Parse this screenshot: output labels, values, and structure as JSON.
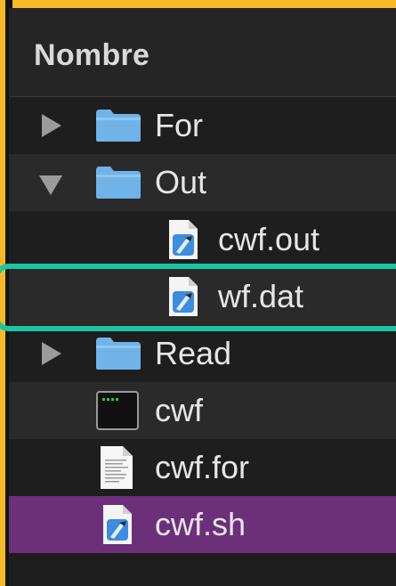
{
  "header": {
    "column_label": "Nombre"
  },
  "rows": [
    {
      "label": "For",
      "kind": "folder",
      "state": "collapsed"
    },
    {
      "label": "Out",
      "kind": "folder",
      "state": "expanded"
    },
    {
      "label": "cwf.out",
      "kind": "xcode-document"
    },
    {
      "label": "wf.dat",
      "kind": "xcode-document"
    },
    {
      "label": "Read",
      "kind": "folder",
      "state": "collapsed"
    },
    {
      "label": "cwf",
      "kind": "terminal-executable"
    },
    {
      "label": "cwf.for",
      "kind": "text-document"
    },
    {
      "label": "cwf.sh",
      "kind": "xcode-document",
      "selected": true
    }
  ],
  "colors": {
    "frame": "#f7b928",
    "background": "#1e1e1f",
    "selection": "#6c2f7a",
    "highlight_outline": "#1bc6a0",
    "folder": "#6fb3e8"
  }
}
